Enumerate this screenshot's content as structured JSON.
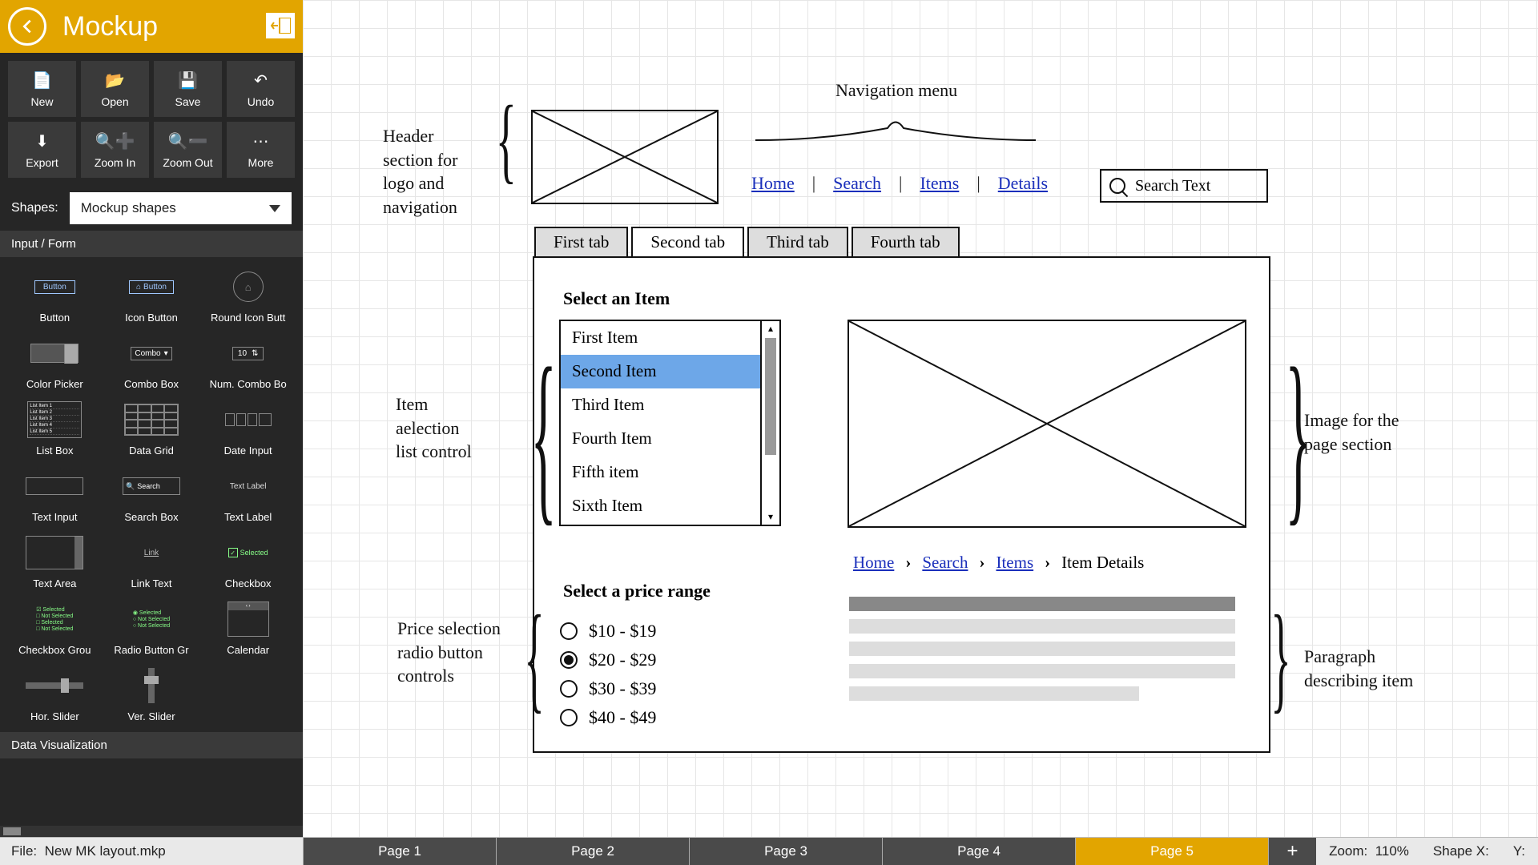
{
  "header": {
    "title": "Mockup"
  },
  "toolbar": {
    "new": "New",
    "open": "Open",
    "save": "Save",
    "undo": "Undo",
    "export": "Export",
    "zoomin": "Zoom In",
    "zoomout": "Zoom Out",
    "more": "More"
  },
  "shapes": {
    "label": "Shapes:",
    "selected": "Mockup shapes"
  },
  "sidebar": {
    "section1": "Input / Form",
    "section2": "Data Visualization",
    "items": {
      "button": "Button",
      "iconbutton": "Icon Button",
      "roundicon": "Round Icon Butt",
      "colorpicker": "Color Picker",
      "combobox": "Combo Box",
      "numcombo": "Num. Combo Bo",
      "listbox": "List Box",
      "datagrid": "Data Grid",
      "dateinput": "Date Input",
      "textinput": "Text Input",
      "searchbox": "Search Box",
      "textlabel": "Text Label",
      "textarea": "Text Area",
      "linktext": "Link Text",
      "checkbox": "Checkbox",
      "checkgroup": "Checkbox Grou",
      "radiogroup": "Radio Button Gr",
      "calendar": "Calendar",
      "hslider": "Hor. Slider",
      "vslider": "Ver. Slider"
    },
    "thumbs": {
      "btn": "Button",
      "iconbtn": "Button",
      "combo": "Combo",
      "num": "10",
      "search": "Search",
      "textlabel": "Text Label",
      "link": "Link",
      "checkbox": "Selected",
      "cg1": "Selected",
      "cg2": "Not Selected",
      "cg3": "Selected",
      "cg4": "Not Selected",
      "rg1": "Selected",
      "rg2": "Not Selected",
      "rg3": "Not Selected",
      "lb1": "List Item 1",
      "lb2": "List Item 2",
      "lb3": "List Item 3",
      "lb4": "List Item 4",
      "lb5": "List Item 5"
    }
  },
  "canvas": {
    "header_note": "Header section for logo and navigation",
    "navmenu_note": "Navigation menu",
    "nav": {
      "home": "Home",
      "search": "Search",
      "items": "Items",
      "details": "Details"
    },
    "search_placeholder": "Search Text",
    "tabs": {
      "t1": "First tab",
      "t2": "Second tab",
      "t3": "Third tab",
      "t4": "Fourth tab"
    },
    "select_item": "Select an Item",
    "list_note": "Item aelection list control",
    "list": {
      "i1": "First Item",
      "i2": "Second Item",
      "i3": "Third Item",
      "i4": "Fourth Item",
      "i5": "Fifth item",
      "i6": "Sixth Item"
    },
    "image_note": "Image for the page section",
    "breadcrumb": {
      "home": "Home",
      "search": "Search",
      "items": "Items",
      "details": "Item Details"
    },
    "price_title": "Select a price range",
    "price_note": "Price selection radio button controls",
    "prices": {
      "p1": "$10 - $19",
      "p2": "$20 - $29",
      "p3": "$30 - $39",
      "p4": "$40 - $49"
    },
    "para_note": "Paragraph describing item"
  },
  "bottom": {
    "file_prefix": "File:",
    "file_name": "New MK layout.mkp",
    "pages": {
      "p1": "Page 1",
      "p2": "Page 2",
      "p3": "Page 3",
      "p4": "Page 4",
      "p5": "Page 5"
    },
    "zoom_label": "Zoom:",
    "zoom_value": "110%",
    "shapex": "Shape X:",
    "y": "Y:"
  }
}
